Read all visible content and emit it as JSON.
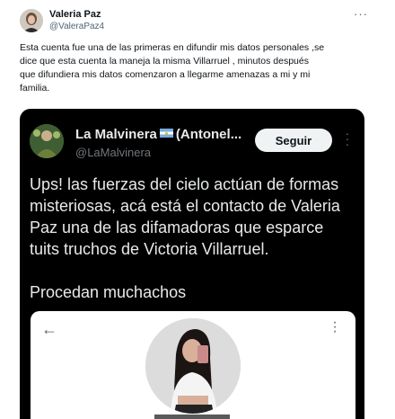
{
  "tweet": {
    "author_name": "Valeria Paz",
    "author_handle": "@ValeraPaz4",
    "more_icon": "···",
    "text_lines": [
      "Esta cuenta fue una de las primeras en difundir mis datos personales ,se",
      "dice que esta cuenta la maneja la misma Villarruel , minutos después",
      "que difundiera mis datos comenzaron a llegarme amenazas a mi y mi",
      "familia."
    ]
  },
  "embedded_tweet": {
    "author_name_before_flag": "La Malvinera",
    "author_name_after_flag": "(Antonel...",
    "author_handle": "@LaMalvinera",
    "follow_label": "Seguir",
    "more_icon": "⋮",
    "text_lines": [
      "Ups! las fuerzas del cielo actúan de formas",
      "misteriosas, acá está el contacto de Valeria",
      "Paz una de las difamadoras que esparce",
      "tuits truchos de Victoria Villarruel."
    ],
    "text_line_2": "Procedan muchachos"
  },
  "profile_card": {
    "back_icon": "←",
    "more_icon": "⋮"
  },
  "colors": {
    "embed_background": "#000000",
    "handle_gray": "#536471",
    "follow_button": "#eff3f4"
  }
}
